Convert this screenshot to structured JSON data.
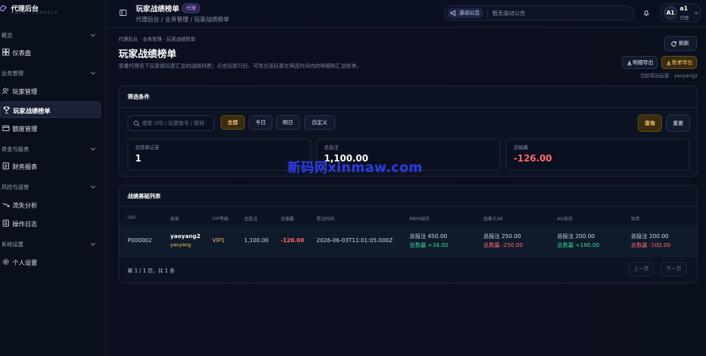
{
  "brand": {
    "title": "代理后台",
    "subtitle": "AGENT CONSOLE"
  },
  "sidebar": {
    "sections": [
      {
        "label": "概览"
      },
      {
        "label": "业务管理"
      },
      {
        "label": "资金与报表"
      },
      {
        "label": "风控与运营"
      },
      {
        "label": "系统设置"
      }
    ],
    "items": [
      {
        "label": "仪表盘",
        "icon": "dashboard-icon"
      },
      {
        "label": "玩家管理",
        "icon": "users-icon"
      },
      {
        "label": "玩家战绩榜单",
        "icon": "trophy-icon",
        "active": true
      },
      {
        "label": "额度管理",
        "icon": "wallet-icon"
      },
      {
        "label": "财务报表",
        "icon": "report-icon"
      },
      {
        "label": "流失分析",
        "icon": "trend-down-icon"
      },
      {
        "label": "操作日志",
        "icon": "log-icon"
      },
      {
        "label": "个人设置",
        "icon": "gear-icon"
      }
    ]
  },
  "header": {
    "title": "玩家战绩榜单",
    "badge": "代理",
    "breadcrumb": "代理后台 / 业务管理 / 玩家战绩榜单",
    "announcement_label": "滚动公告",
    "announcement_text": "暂无滚动公告",
    "user": {
      "avatar": "A1",
      "name": "a1",
      "role": "代理"
    }
  },
  "page": {
    "breadcrumb": "代理后台  ·  业务管理  ·  玩家战绩榜单",
    "title": "玩家战绩榜单",
    "description": "查看代理名下玩家按玩家汇总的战绩列表；点击玩家行后，可导出该玩家在筛选时间内的明细和汇总账单。",
    "refresh_label": "刷新",
    "export_detail_label": "明细导出",
    "export_bill_label": "账单导出",
    "export_hint": "当前导出玩家：yaoyang2"
  },
  "filter": {
    "title": "筛选条件",
    "search_placeholder": "搜索 UID / 玩家账号 / 昵称",
    "chips": [
      "全部",
      "今日",
      "明日",
      "自定义"
    ],
    "query_label": "查询",
    "reset_label": "重置",
    "stats": [
      {
        "label": "总榜单记录",
        "value": "1"
      },
      {
        "label": "总投注",
        "value": "1,100.00"
      },
      {
        "label": "总输赢",
        "value": "-126.00"
      }
    ]
  },
  "table": {
    "title": "战绩基础列表",
    "columns": [
      "UID",
      "玩家",
      "VIP等级",
      "总投注",
      "总输赢",
      "投注时间",
      "BBIN视讯",
      "加拿大28",
      "AG视讯",
      "体育"
    ],
    "rows": [
      {
        "uid": "P000002",
        "player_name": "yaoyang2",
        "player_account": "yaoyang",
        "vip": "VIP1",
        "total_bet": "1,100.00",
        "total_win": "-126.00",
        "bet_time": "2026-06-03T11:01:05.000Z",
        "bbin": {
          "bet": "总投注 450.00",
          "win": "总数赢 +34.00"
        },
        "canada28": {
          "bet": "总投注 250.00",
          "win": "总数赢 -250.00"
        },
        "ag": {
          "bet": "总投注 200.00",
          "win": "总数赢 +190.00"
        },
        "sports": {
          "bet": "总投注 200.00",
          "win": "总数赢 -100.00"
        }
      }
    ],
    "pager_info": "第 1 / 1 页，共 1 条",
    "prev_label": "上一页",
    "next_label": "下一页"
  },
  "watermark": "新码网xinmaw.com",
  "colors": {
    "accent": "#f7c765",
    "negative": "#ff6b6b",
    "positive": "#3ddc97",
    "background": "#070b16"
  }
}
